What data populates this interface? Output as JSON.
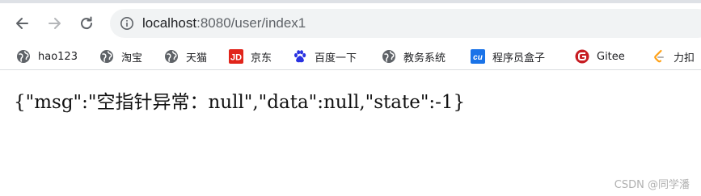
{
  "browser": {
    "address_bar": {
      "url_host": "localhost",
      "url_rest": ":8080/user/index1"
    },
    "nav_icons": [
      "back-arrow-icon",
      "forward-arrow-icon",
      "reload-icon",
      "site-info-icon"
    ],
    "bookmarks": [
      {
        "label": "hao123",
        "icon": "globe-icon"
      },
      {
        "label": "淘宝",
        "icon": "globe-icon"
      },
      {
        "label": "天猫",
        "icon": "globe-icon"
      },
      {
        "label": "京东",
        "icon": "jd-logo-icon"
      },
      {
        "label": "百度一下",
        "icon": "baidu-paw-icon"
      },
      {
        "label": "教务系统",
        "icon": "globe-icon"
      },
      {
        "label": "程序员盒子",
        "icon": "cu-logo-icon"
      },
      {
        "label": "Gitee",
        "icon": "gitee-logo-icon"
      },
      {
        "label": "力扣",
        "icon": "leetcode-logo-icon"
      }
    ]
  },
  "page": {
    "body_text": "{\"msg\":\"空指针异常：null\",\"data\":null,\"state\":-1}"
  },
  "watermark": {
    "text": "CSDN @同学潘"
  },
  "colors": {
    "toolbar_bg": "#ffffff",
    "omnibox_bg": "#f1f3f4",
    "icon_gray": "#5f6368",
    "jd_red": "#e1251b",
    "baidu_blue": "#2932e1",
    "cu_blue": "#1a73e8",
    "gitee_red": "#c71d23",
    "leetcode_orange": "#ffa116"
  }
}
